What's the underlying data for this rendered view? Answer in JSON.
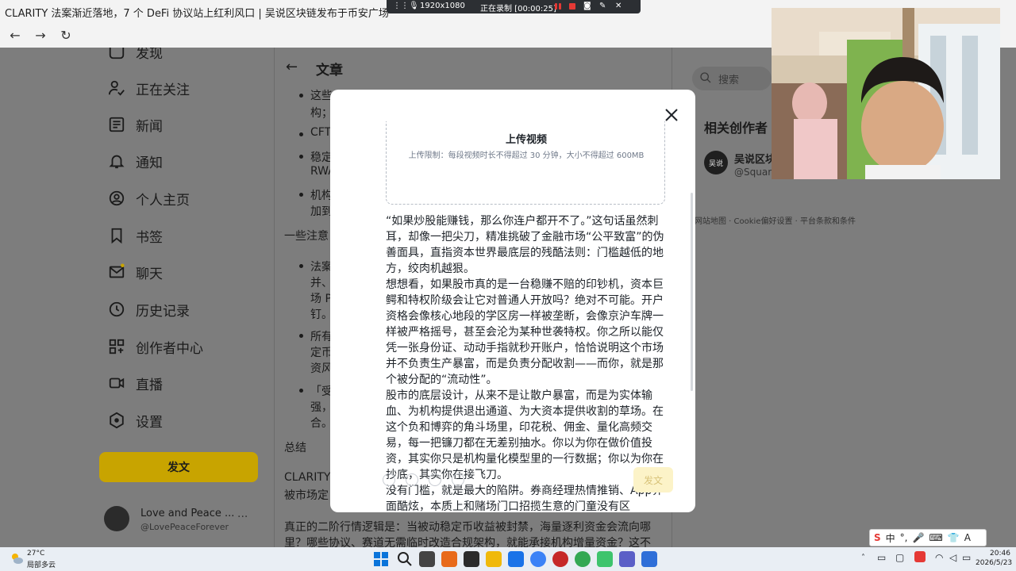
{
  "browser": {
    "tab_title": "CLARITY 法案渐近落地，7 个 DeFi 协议站上红利风口 | 吴说区块链发布于币安广场"
  },
  "recorder": {
    "resolution": "1920x1080",
    "status": "正在录制 [00:00:25]"
  },
  "sidebar": {
    "items": [
      {
        "label": "发现",
        "icon": "discover-icon"
      },
      {
        "label": "正在关注",
        "icon": "following-icon"
      },
      {
        "label": "新闻",
        "icon": "news-icon"
      },
      {
        "label": "通知",
        "icon": "bell-icon"
      },
      {
        "label": "个人主页",
        "icon": "profile-icon"
      },
      {
        "label": "书签",
        "icon": "bookmark-icon"
      },
      {
        "label": "聊天",
        "icon": "mail-icon"
      },
      {
        "label": "历史记录",
        "icon": "clock-icon"
      },
      {
        "label": "创作者中心",
        "icon": "grid-icon"
      },
      {
        "label": "直播",
        "icon": "video-icon"
      },
      {
        "label": "设置",
        "icon": "settings-icon"
      }
    ],
    "post_button": "发文",
    "profile_name": "Love and Peace ...",
    "profile_handle": "@LovePeaceForever"
  },
  "article": {
    "header": "文章",
    "fragments": {
      "f1": "这些",
      "f1b": "构；",
      "f2": "CFT",
      "f3": "稳定",
      "f3b": "RWA",
      "f4": "机构",
      "f4b": "加到",
      "f5": "一些注意",
      "f6": "法案",
      "f6b": "并、",
      "f6c": "场 P",
      "f6d": "钉。",
      "f7": "所有",
      "f7b": "定币",
      "f7c": "资风",
      "f8": "「受",
      "f8b": "强，",
      "f8c": "合。",
      "summary": "总结",
      "f9": "CLARITY",
      "f9b": "被市场定",
      "line1": "真正的二阶行情逻辑是：当被动稳定币收益被封禁，海量逐利资金会流向哪",
      "line2": "里？哪些协议、赛道无需临时改造合规架构，就能承接机构增量资金？这不"
    }
  },
  "right_panel": {
    "search_placeholder": "搜索",
    "related_title": "相关创作者",
    "creator_name": "吴说区块",
    "creator_handle": "@Square",
    "creator_avatar_text": "吴说",
    "footer_links": "网站地图 · Cookie偏好设置 · 平台条款和条件"
  },
  "modal": {
    "upload_title": "上传视频",
    "upload_limit": "上传限制：每段视频时长不得超过 30 分钟，大小不得超过 600MB",
    "paragraphs": [
      "“如果炒股能赚钱，那么你连户都开不了。”这句话虽然刺耳，却像一把尖刀，精准挑破了金融市场“公平致富”的伪善面具，直指资本世界最底层的残酷法则：门槛越低的地方，绞肉机越狠。",
      "想想看，如果股市真的是一台稳赚不赔的印钞机，资本巨鳄和特权阶级会让它对普通人开放吗？绝对不可能。开户资格会像核心地段的学区房一样被垄断，会像京沪车牌一样被严格摇号，甚至会沦为某种世袭特权。你之所以能仅凭一张身份证、动动手指就秒开账户，恰恰说明这个市场并不负责生产暴富，而是负责分配收割——而你，就是那个被分配的“流动性”。",
      "股市的底层设计，从来不是让散户暴富，而是为实体输血、为机构提供退出通道、为大资本提供收割的草场。在这个负和博弈的角斗场里，印花税、佣金、量化高频交易，每一把镰刀都在无差别抽水。你以为你在做价值投资，其实你只是机构量化模型里的一行数据；你以为你在抄底，其实你在接飞刀。",
      "没有门槛，就是最大的陷阱。券商经理热情推销、App界面酷炫，本质上和赌场门口招揽生意的门童没有区"
    ],
    "post_button": "发文"
  },
  "taskbar": {
    "weather_temp": "27°C",
    "weather_desc": "局部多云",
    "time": "20:46",
    "date": "2026/5/23"
  },
  "ime": {
    "lang": "中"
  }
}
